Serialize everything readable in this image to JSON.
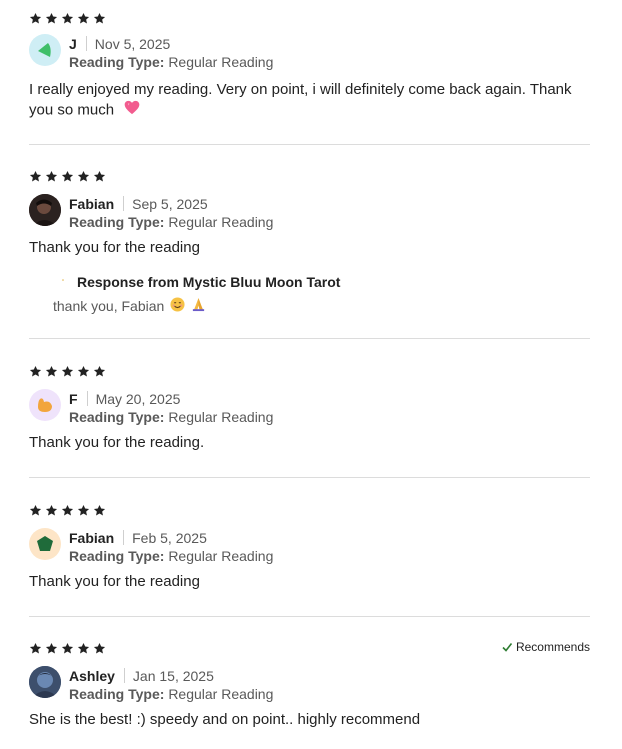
{
  "reviews": [
    {
      "rating": 5,
      "name": "J",
      "date": "Nov 5, 2025",
      "reading_type_label": "Reading Type:",
      "reading_type": "Regular Reading",
      "text": "I really enjoyed my reading. Very on point, i will definitely come back again. Thank you so much",
      "avatar_icon": "green-leaf-shape",
      "text_emoji": "pink-heart-emoji"
    },
    {
      "rating": 5,
      "name": "Fabian",
      "date": "Sep 5, 2025",
      "reading_type_label": "Reading Type:",
      "reading_type": "Regular Reading",
      "text": "Thank you for the reading",
      "avatar_icon": "user-photo",
      "response": {
        "title": "Response from Mystic Bluu Moon Tarot",
        "text": "thank you, Fabian",
        "icon": "moon-icon",
        "emojis": [
          "smiling-face-emoji",
          "folded-hands-emoji"
        ]
      }
    },
    {
      "rating": 5,
      "name": "F",
      "date": "May 20, 2025",
      "reading_type_label": "Reading Type:",
      "reading_type": "Regular Reading",
      "text": "Thank you for the reading.",
      "avatar_icon": "orange-blob-shape"
    },
    {
      "rating": 5,
      "name": "Fabian",
      "date": "Feb 5, 2025",
      "reading_type_label": "Reading Type:",
      "reading_type": "Regular Reading",
      "text": "Thank you for the reading",
      "avatar_icon": "green-pentagon-shape"
    },
    {
      "rating": 5,
      "name": "Ashley",
      "date": "Jan 15, 2025",
      "reading_type_label": "Reading Type:",
      "reading_type": "Regular Reading",
      "text": "She is the best! :) speedy and on point.. highly recommend",
      "avatar_icon": "user-photo",
      "recommends": "Recommends"
    }
  ],
  "colors": {
    "star": "#222222",
    "muted_text": "#595959",
    "divider": "#dcdcdc",
    "avatar_teal_bg": "#cfeef5",
    "avatar_green": "#3fbf69",
    "avatar_purple_bg": "#efe3fb",
    "avatar_orange": "#f2a53d",
    "avatar_peach_bg": "#fde5c7",
    "avatar_dark_green": "#1f6b3a",
    "recommend_check": "#2e7d32"
  }
}
